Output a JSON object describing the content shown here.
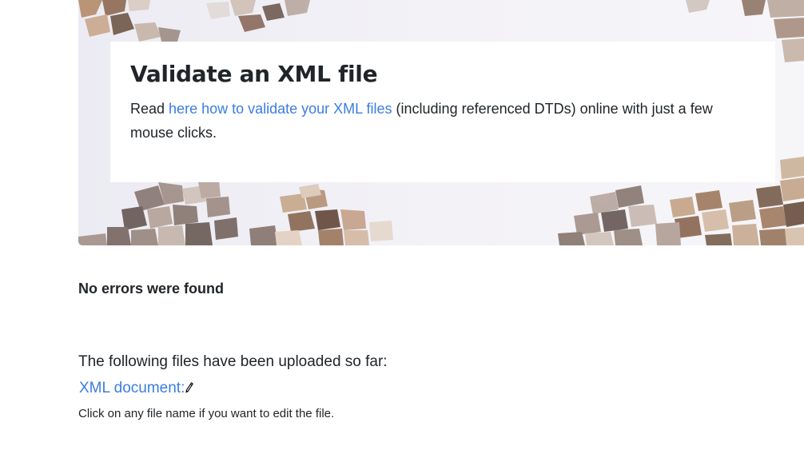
{
  "hero": {
    "title": "Validate an XML file",
    "intro_prefix": "Read ",
    "intro_link": "here how to validate your XML files",
    "intro_suffix": " (including referenced DTDs) online with just a few mouse clicks."
  },
  "result": {
    "message": "No errors were found"
  },
  "files": {
    "heading": "The following files have been uploaded so far:",
    "items": [
      {
        "label": "XML document:",
        "icon": "pencil-icon"
      }
    ],
    "hint": "Click on any file name if you want to edit the file."
  },
  "colors": {
    "link": "#3b7de0",
    "text": "#212529",
    "card_bg": "#ffffff"
  }
}
